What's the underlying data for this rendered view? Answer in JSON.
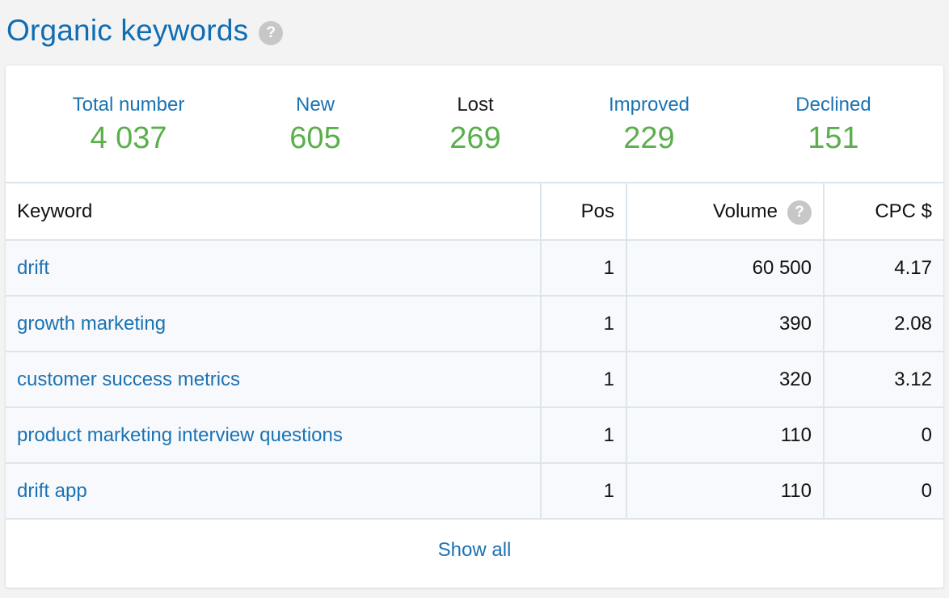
{
  "page": {
    "title": "Organic keywords",
    "help_glyph": "?"
  },
  "stats": [
    {
      "label": "Total number",
      "value": "4 037"
    },
    {
      "label": "New",
      "value": "605"
    },
    {
      "label": "Lost",
      "value": "269"
    },
    {
      "label": "Improved",
      "value": "229"
    },
    {
      "label": "Declined",
      "value": "151"
    }
  ],
  "table": {
    "columns": [
      "Keyword",
      "Pos",
      "Volume",
      "CPC $"
    ],
    "rows": [
      {
        "keyword": "drift",
        "pos": "1",
        "volume": "60 500",
        "cpc": "4.17"
      },
      {
        "keyword": "growth marketing",
        "pos": "1",
        "volume": "390",
        "cpc": "2.08"
      },
      {
        "keyword": "customer success metrics",
        "pos": "1",
        "volume": "320",
        "cpc": "3.12"
      },
      {
        "keyword": "product marketing interview questions",
        "pos": "1",
        "volume": "110",
        "cpc": "0"
      },
      {
        "keyword": "drift app",
        "pos": "1",
        "volume": "110",
        "cpc": "0"
      }
    ]
  },
  "footer": {
    "show_all": "Show all"
  },
  "colors": {
    "link_blue": "#1b73b3",
    "title_blue": "#0f6db3",
    "value_green": "#5aaf4c",
    "help_grey": "#c7c7c7"
  }
}
